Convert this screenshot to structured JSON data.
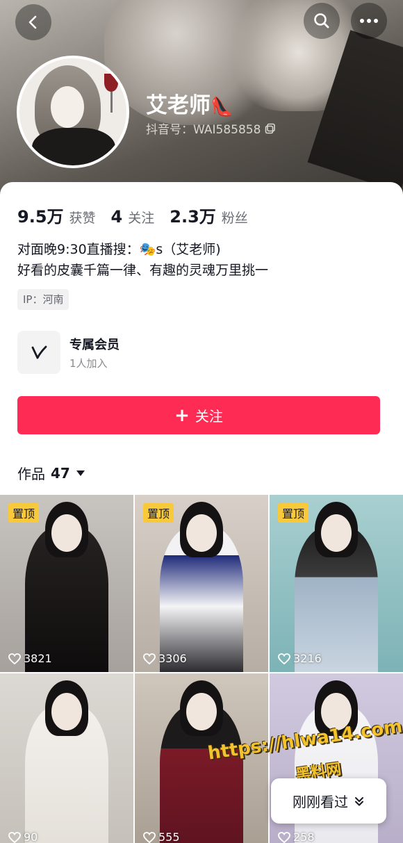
{
  "header": {
    "nickname": "艾老师",
    "nickname_emoji": "👠",
    "douyin_id": "抖音号：WAI585858"
  },
  "icons": {
    "back": "chevron-left-icon",
    "search": "search-icon",
    "more": "more-dots-icon",
    "copy": "copy-icon",
    "member": "v-logo-icon",
    "heart": "heart-outline-icon",
    "caret": "caret-down-icon"
  },
  "stats": [
    {
      "value": "9.5万",
      "label": "获赞"
    },
    {
      "value": "4",
      "label": "关注"
    },
    {
      "value": "2.3万",
      "label": "粉丝"
    }
  ],
  "bio": {
    "line1": "对面晚9:30直播搜：🎭s（艾老师)",
    "line2": "好看的皮囊千篇一律、有趣的灵魂万里挑一"
  },
  "ip_tag": "IP：河南",
  "member": {
    "title": "专属会员",
    "subtitle": "1人加入"
  },
  "follow_button": {
    "plus": "+",
    "label": "关注"
  },
  "works": {
    "label": "作品",
    "count": "47"
  },
  "videos": [
    {
      "pinned": "置顶",
      "likes": "3821"
    },
    {
      "pinned": "置顶",
      "likes": "3306"
    },
    {
      "pinned": "置顶",
      "likes": "3216"
    },
    {
      "pinned": "",
      "likes": "90"
    },
    {
      "pinned": "",
      "likes": "555"
    },
    {
      "pinned": "",
      "likes": "258"
    }
  ],
  "watermark": {
    "url": "https://hlwa14.com",
    "name": "黑料网"
  },
  "recent_button": {
    "label": "刚刚看过"
  },
  "colors": {
    "accent": "#fe2c55",
    "pin_badge": "#f8c93a"
  }
}
